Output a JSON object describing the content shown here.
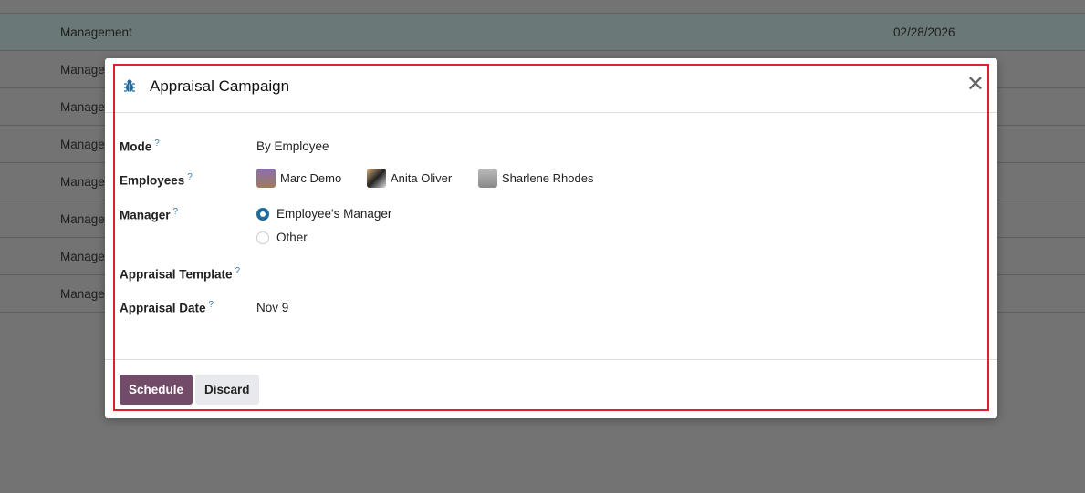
{
  "background_list": {
    "rows": [
      {
        "name": "Management",
        "date": "02/28/2026",
        "highlighted": true
      },
      {
        "name": "Manage"
      },
      {
        "name": "Manage"
      },
      {
        "name": "Manage"
      },
      {
        "name": "Manage"
      },
      {
        "name": "Manage"
      },
      {
        "name": "Manage"
      },
      {
        "name": "Manage"
      }
    ]
  },
  "dialog": {
    "title": "Appraisal Campaign",
    "icon": "bug-icon",
    "fields": {
      "mode_label": "Mode",
      "mode_value": "By Employee",
      "employees_label": "Employees",
      "manager_label": "Manager",
      "template_label": "Appraisal Template",
      "date_label": "Appraisal Date",
      "date_value": "Nov 9",
      "help": "?"
    },
    "employees": [
      "Marc Demo",
      "Anita Oliver",
      "Sharlene Rhodes"
    ],
    "manager_options": [
      {
        "label": "Employee's Manager",
        "selected": true
      },
      {
        "label": "Other",
        "selected": false
      }
    ],
    "buttons": {
      "schedule": "Schedule",
      "discard": "Discard"
    },
    "colors": {
      "primary": "#714b67",
      "accent": "#1f6b9e",
      "highlight": "#e0202a"
    }
  }
}
